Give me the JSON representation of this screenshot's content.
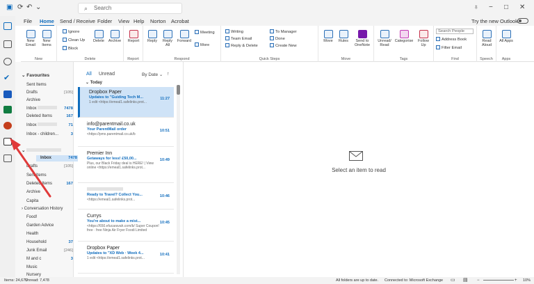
{
  "titlebar": {
    "search_placeholder": "Search"
  },
  "menu": {
    "tabs": [
      "File",
      "Home",
      "Send / Receive",
      "Folder",
      "View",
      "Help",
      "Norton",
      "Acrobat"
    ],
    "active": "Home",
    "try_new": "Try the new Outlook"
  },
  "ribbon": {
    "new_email": "New Email",
    "new_items": "New Items",
    "ignore": "Ignore",
    "clean_up": "Clean Up",
    "block": "Block",
    "delete": "Delete",
    "archive": "Archive",
    "report": "Report",
    "reply": "Reply",
    "reply_all": "Reply All",
    "forward": "Forward",
    "meeting": "Meeting",
    "more": "More",
    "writing": "Writing",
    "team_email": "Team Email",
    "reply_delete": "Reply & Delete",
    "to_manager": "To Manager",
    "done": "Done",
    "create_new": "Create New",
    "move": "Move",
    "rules": "Rules",
    "send_onenote": "Send to OneNote",
    "unread_read": "Unread/ Read",
    "categorise": "Categorise",
    "follow_up": "Follow Up",
    "search_people": "Search People",
    "address_book": "Address Book",
    "filter_email": "Filter Email",
    "read_aloud": "Read Aloud",
    "all_apps": "All Apps",
    "groups": {
      "new": "New",
      "delete": "Delete",
      "report": "Report",
      "respond": "Respond",
      "quick_steps": "Quick Steps",
      "move": "Move",
      "tags": "Tags",
      "find": "Find",
      "speech": "Speech",
      "apps": "Apps"
    }
  },
  "folders": {
    "favourites_label": "Favourites",
    "fav": [
      {
        "name": "Sent Items",
        "count": ""
      },
      {
        "name": "Drafts",
        "count": "[105]"
      },
      {
        "name": "Archive",
        "count": ""
      },
      {
        "name": "Inbox",
        "count": "7478"
      },
      {
        "name": "Deleted Items",
        "count": "167"
      },
      {
        "name": "Inbox",
        "count": "71"
      },
      {
        "name": "Inbox - children...",
        "count": "3"
      }
    ],
    "account": [
      {
        "name": "Inbox",
        "count": "7478"
      },
      {
        "name": "Drafts",
        "count": "[105]"
      },
      {
        "name": "Sent Items",
        "count": ""
      },
      {
        "name": "Deleted Items",
        "count": "167"
      },
      {
        "name": "Archive",
        "count": ""
      },
      {
        "name": "Capita",
        "count": ""
      },
      {
        "name": "Conversation History",
        "count": ""
      },
      {
        "name": "Food!",
        "count": ""
      },
      {
        "name": "Garden Advice",
        "count": ""
      },
      {
        "name": "Health",
        "count": ""
      },
      {
        "name": "Household",
        "count": "37"
      },
      {
        "name": "Junk Email",
        "count": "[246]"
      },
      {
        "name": "M and c",
        "count": "3"
      },
      {
        "name": "Music",
        "count": ""
      },
      {
        "name": "Nursery",
        "count": ""
      }
    ]
  },
  "list": {
    "tab_all": "All",
    "tab_unread": "Unread",
    "sort": "By Date",
    "today": "Today",
    "messages": [
      {
        "sender": "Dropbox Paper",
        "subject": "Updates to \"Guiding Tech M...",
        "preview": "1 edit <https://emeal1.safelinks.prot...",
        "time": "11:27"
      },
      {
        "sender": "info@parentmail.co.uk",
        "subject": "Your ParentMail order",
        "preview": "<https://pmx.parentmail.co.uk/b",
        "time": "10:51"
      },
      {
        "sender": "Premier Inn",
        "subject": "Getaways for less! £50,00...",
        "preview": "Plus, our Black Friday deal is HERE! | View online <https://emeal1.safelinks.prot...",
        "time": "10:49"
      },
      {
        "sender": "",
        "subject": "Ready to Travel? Collect You...",
        "preview": "<https://emeal1.safelinks.prot...",
        "time": "10:46"
      },
      {
        "sender": "Currys",
        "subject": "You're about to make a mist...",
        "preview": "<https://650.efucaravah.com/b/ Super Coupon! free · free Ninja Air Fryer Foodi Limited",
        "time": "10:45"
      },
      {
        "sender": "Dropbox Paper",
        "subject": "Updates to \"XD Web · Week 4...",
        "preview": "1 edit <https://emeal1.safelinks.prot...",
        "time": "10:41"
      }
    ]
  },
  "reading": {
    "message": "Select an item to read"
  },
  "status": {
    "items": "Items: 24,676",
    "unread": "Unread: 7,478",
    "updated": "All folders are up to date.",
    "connected": "Connected to: Microsoft Exchange",
    "zoom": "10%"
  }
}
